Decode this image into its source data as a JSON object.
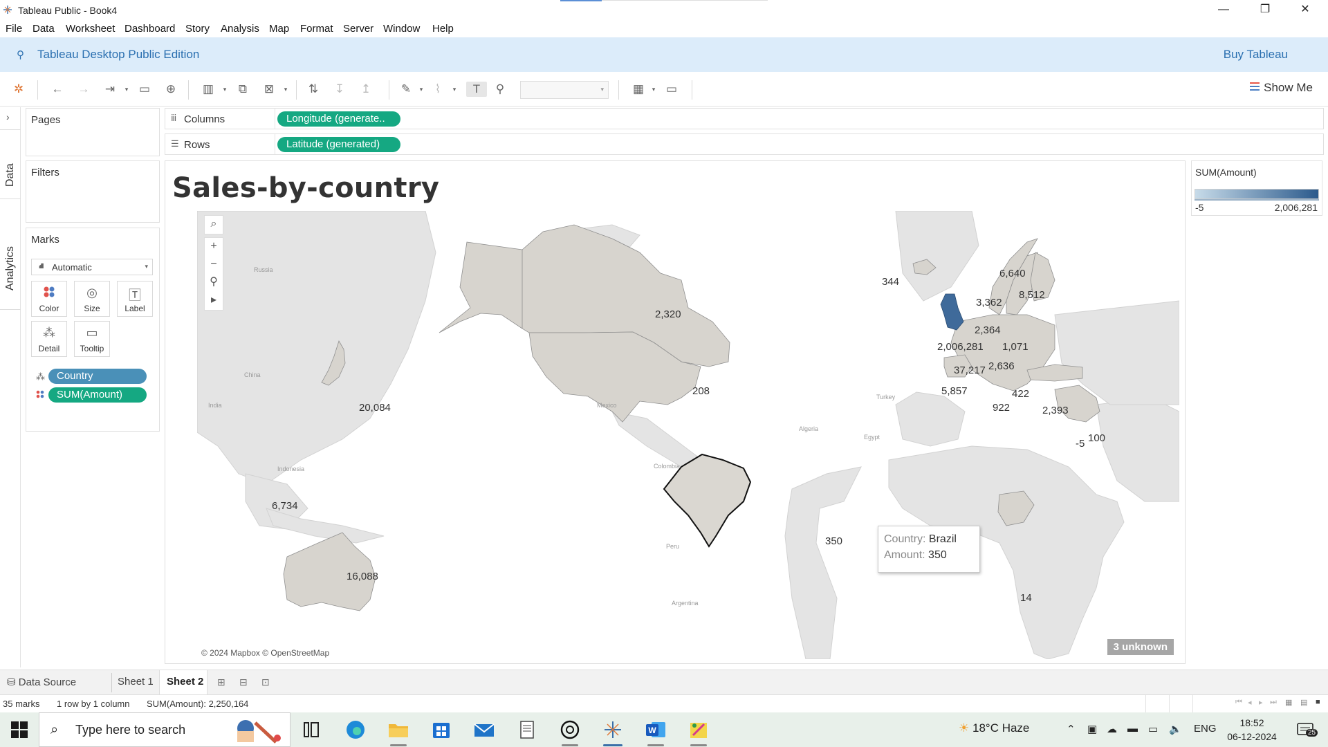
{
  "window": {
    "title": "Tableau Public - Book4",
    "controls": {
      "minimize": "—",
      "restore": "❐",
      "close": "✕"
    }
  },
  "menu": [
    "File",
    "Data",
    "Worksheet",
    "Dashboard",
    "Story",
    "Analysis",
    "Map",
    "Format",
    "Server",
    "Window",
    "Help"
  ],
  "banner": {
    "edition": "Tableau Desktop Public Edition",
    "buy": "Buy Tableau"
  },
  "toolbar": {
    "show_me": "Show Me"
  },
  "side_tabs": {
    "data": "Data",
    "analytics": "Analytics"
  },
  "pages_card": {
    "title": "Pages"
  },
  "filters_card": {
    "title": "Filters"
  },
  "marks_card": {
    "title": "Marks",
    "mark_type": "Automatic",
    "buttons": {
      "color": "Color",
      "size": "Size",
      "label": "Label",
      "detail": "Detail",
      "tooltip": "Tooltip"
    },
    "fields": {
      "country": "Country",
      "amount": "SUM(Amount)"
    }
  },
  "shelves": {
    "columns": {
      "name": "Columns",
      "pill": "Longitude (generate.."
    },
    "rows": {
      "name": "Rows",
      "pill": "Latitude (generated)"
    }
  },
  "sheet": {
    "title": "Sales-by-country",
    "attribution": "© 2024 Mapbox © OpenStreetMap",
    "unknown": "3 unknown",
    "place_names": {
      "russia": "Russia",
      "china": "China",
      "india": "India",
      "indonesia": "Indonesia",
      "mexico": "Mexico",
      "colombia": "Colombia",
      "peru": "Peru",
      "argentina": "Argentina",
      "algeria": "Algeria",
      "egypt": "Egypt",
      "turkey": "Turkey"
    },
    "labels": {
      "canada": "2,320",
      "usa": "208",
      "japan": "20,084",
      "indonesia": "6,734",
      "australia": "16,088",
      "brazil": "350",
      "iceland": "344",
      "norway": "6,640",
      "finland": "8,512",
      "sweden": "3,362",
      "denmark": "2,364",
      "uk": "2,006,281",
      "poland": "1,071",
      "france": "37,217",
      "austria": "2,636",
      "spain": "5,857",
      "italy": "922",
      "greece": "422",
      "turkey": "2,393",
      "saudi": "100",
      "saudi2": "-5",
      "south_africa": "14"
    },
    "tooltip": {
      "country_key": "Country:",
      "country_val": "Brazil",
      "amount_key": "Amount:",
      "amount_val": "350"
    }
  },
  "legend": {
    "title": "SUM(Amount)",
    "min": "-5",
    "max": "2,006,281",
    "color_low": "#c7dbe9",
    "color_high": "#2b5a8c"
  },
  "sheet_tabs": {
    "data_source": "Data Source",
    "sheet1": "Sheet 1",
    "sheet2": "Sheet 2"
  },
  "status": {
    "marks": "35 marks",
    "layout": "1 row by 1 column",
    "sum": "SUM(Amount): 2,250,164"
  },
  "taskbar": {
    "search_placeholder": "Type here to search",
    "weather": "18°C  Haze",
    "lang": "ENG",
    "time": "18:52",
    "date": "06-12-2024",
    "notifications": "25"
  },
  "colors": {
    "accent_green": "#15a882",
    "accent_blue": "#4a90b8",
    "banner_bg": "#dcecfa",
    "banner_text": "#2a6fb0",
    "land": "#e1e1e1",
    "data_land": "#d9d7d2",
    "uk": "#3f6a9a"
  }
}
